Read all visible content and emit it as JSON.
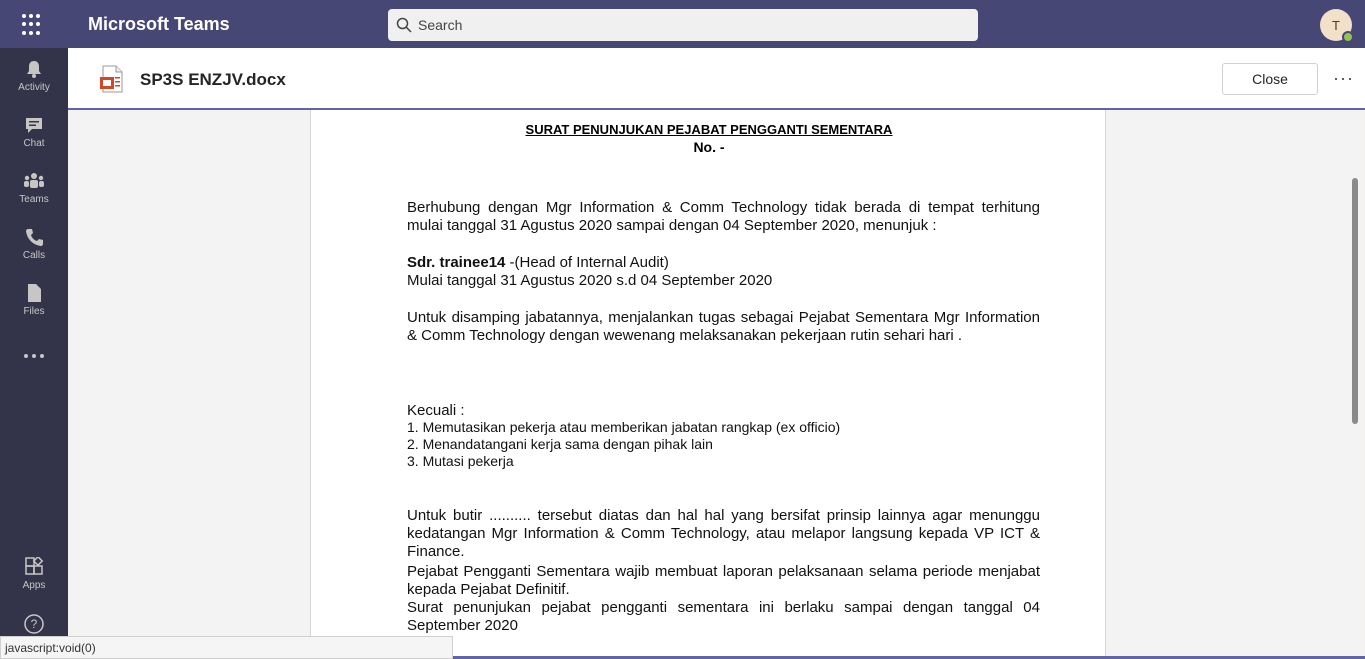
{
  "header": {
    "app_title": "Microsoft Teams",
    "search_placeholder": "Search",
    "avatar_initial": "T",
    "brand_color": "#464775"
  },
  "rail": {
    "items": [
      {
        "label": "Activity",
        "icon": "bell-icon"
      },
      {
        "label": "Chat",
        "icon": "chat-icon"
      },
      {
        "label": "Teams",
        "icon": "teams-icon"
      },
      {
        "label": "Calls",
        "icon": "phone-icon"
      },
      {
        "label": "Files",
        "icon": "file-icon"
      },
      {
        "label": "",
        "icon": "more-horizontal-icon"
      },
      {
        "label": "Apps",
        "icon": "apps-icon"
      },
      {
        "label": "",
        "icon": "help-icon"
      }
    ]
  },
  "file": {
    "name": "SP3S ENZJV.docx",
    "close_label": "Close",
    "more_label": "···"
  },
  "document": {
    "title": "SURAT PENUNJUKAN PEJABAT PENGGANTI SEMENTARA",
    "number": "No. -",
    "para1": "Berhubung dengan Mgr Information & Comm Technology tidak berada di tempat terhitung mulai tanggal 31 Agustus 2020 sampai dengan 04 September 2020, menunjuk :",
    "appointee_name": "Sdr. trainee14",
    "appointee_role": " -(Head of Internal Audit)",
    "period": "Mulai tanggal 31 Agustus 2020 s.d 04 September 2020",
    "para2": "Untuk disamping jabatannya, menjalankan tugas sebagai Pejabat Sementara Mgr Information & Comm Technology dengan wewenang melaksanakan pekerjaan rutin sehari hari .",
    "except_label": "Kecuali :",
    "except_items": [
      "1. Memutasikan pekerja atau memberikan jabatan rangkap (ex officio)",
      "2. Menandatangani kerja sama dengan pihak lain",
      "3. Mutasi pekerja"
    ],
    "para3": "Untuk butir .......... tersebut diatas dan hal hal yang bersifat prinsip lainnya agar menunggu kedatangan Mgr Information & Comm Technology, atau melapor langsung kepada VP ICT & Finance.",
    "para4": "Pejabat Pengganti Sementara wajib membuat laporan pelaksanaan selama periode menjabat kepada Pejabat Definitif.",
    "para5": "Surat penunjukan pejabat pengganti sementara ini berlaku sampai dengan tanggal 04 September 2020"
  },
  "status": {
    "text": "javascript:void(0)"
  }
}
